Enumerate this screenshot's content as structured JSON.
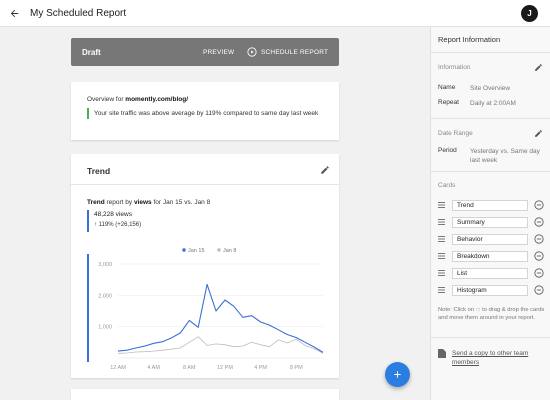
{
  "header": {
    "title": "My Scheduled Report",
    "avatar_initial": "J"
  },
  "toolbar": {
    "status": "Draft",
    "preview_label": "PREVIEW",
    "schedule_label": "SCHEDULE REPORT"
  },
  "overview": {
    "prefix": "Overview for ",
    "site": "momently.com/blog/",
    "note": "Your site traffic was above average by 119% compared to same day last week"
  },
  "trend": {
    "title": "Trend",
    "report_word": "Trend",
    "report_mid": " report by ",
    "metric": "views",
    "range": " for Jan 15 vs. Jan 8",
    "views_label": "48,228 views",
    "delta_label": "↑ 119% (+26,156)"
  },
  "chart_data": {
    "type": "line",
    "x": [
      "12 AM",
      "1 AM",
      "2 AM",
      "3 AM",
      "4 AM",
      "5 AM",
      "6 AM",
      "7 AM",
      "8 AM",
      "9 AM",
      "10 AM",
      "11 AM",
      "12 PM",
      "1 PM",
      "2 PM",
      "3 PM",
      "4 PM",
      "5 PM",
      "6 PM",
      "7 PM",
      "8 PM",
      "9 PM",
      "10 PM",
      "11 PM"
    ],
    "x_tick_labels": [
      "12 AM",
      "4 AM",
      "8 AM",
      "12 PM",
      "4 PM",
      "8 PM"
    ],
    "y_tick_labels": [
      "1,000",
      "2,000",
      "3,000"
    ],
    "ylim": [
      0,
      3000
    ],
    "legend": [
      "Jan 15",
      "Jan 8"
    ],
    "legend_position": "top-center",
    "grid": true,
    "series": [
      {
        "name": "Jan 15",
        "color": "#3a6fd8",
        "values": [
          220,
          250,
          320,
          380,
          470,
          520,
          640,
          800,
          1200,
          980,
          2350,
          1500,
          1850,
          1650,
          1300,
          1350,
          1150,
          1050,
          900,
          750,
          650,
          500,
          350,
          180
        ]
      },
      {
        "name": "Jan 8",
        "color": "#bdbdbd",
        "values": [
          150,
          160,
          190,
          200,
          220,
          250,
          280,
          320,
          500,
          680,
          400,
          450,
          420,
          360,
          380,
          500,
          420,
          360,
          580,
          480,
          600,
          400,
          300,
          150
        ]
      }
    ]
  },
  "panel": {
    "title": "Report Information",
    "information_label": "Information",
    "name_key": "Name",
    "name_val": "Site Overview",
    "repeat_key": "Repeat",
    "repeat_val": "Daily at 2:00AM",
    "date_range_label": "Date Range",
    "period_key": "Period",
    "period_val": "Yesterday vs. Same day last week",
    "cards_label": "Cards",
    "cards": [
      "Trend",
      "Summary",
      "Behavior",
      "Breakdown",
      "List",
      "Histogram"
    ],
    "note": "Note: Click on ::: to drag & drop the cards and move them around in your report.",
    "send_copy": "Send a copy to other team members"
  },
  "colors": {
    "primary": "#2a7de1",
    "draft_bar": "#777777",
    "success": "#4caf50"
  }
}
